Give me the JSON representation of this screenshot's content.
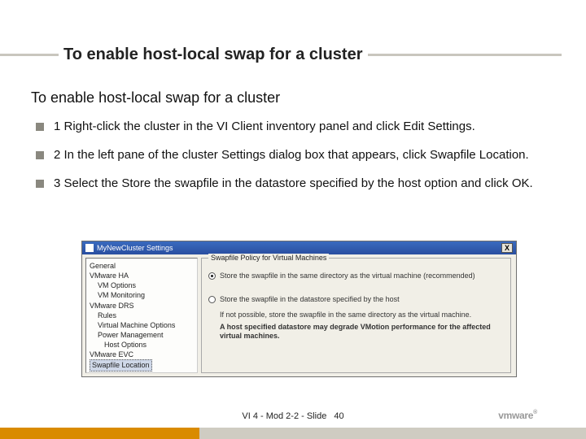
{
  "header": {
    "title": "To enable host-local swap for a cluster"
  },
  "subtitle": "To enable host-local swap for a cluster",
  "bullets": [
    "1 Right-click the cluster in the VI Client inventory panel and click Edit Settings.",
    "2 In the left pane of the cluster Settings dialog box that appears, click Swapfile Location.",
    "3 Select the Store the swapfile in the datastore specified by the host option and click OK."
  ],
  "dialog": {
    "title": "MyNewCluster Settings",
    "close": "X",
    "tree": {
      "general": "General",
      "ha": "VMware HA",
      "vm_options": "VM Options",
      "vm_monitoring": "VM Monitoring",
      "drs": "VMware DRS",
      "rules": "Rules",
      "vm_machine_options": "Virtual Machine Options",
      "power_mgmt": "Power Management",
      "host_options": "Host Options",
      "evc": "VMware EVC",
      "swapfile": "Swapfile Location"
    },
    "group_label": "Swapfile Policy for Virtual Machines",
    "radio1": "Store the swapfile in the same directory as the virtual machine (recommended)",
    "radio2": "Store the swapfile in the datastore specified by the host",
    "note1": "If not possible, store the swapfile in the same directory as the virtual machine.",
    "note2": "A host specified datastore may degrade VMotion performance for the affected virtual machines."
  },
  "footer": {
    "text": "VI 4 - Mod 2-2 - Slide",
    "num": "40",
    "logo": "vmware",
    "reg": "®"
  }
}
